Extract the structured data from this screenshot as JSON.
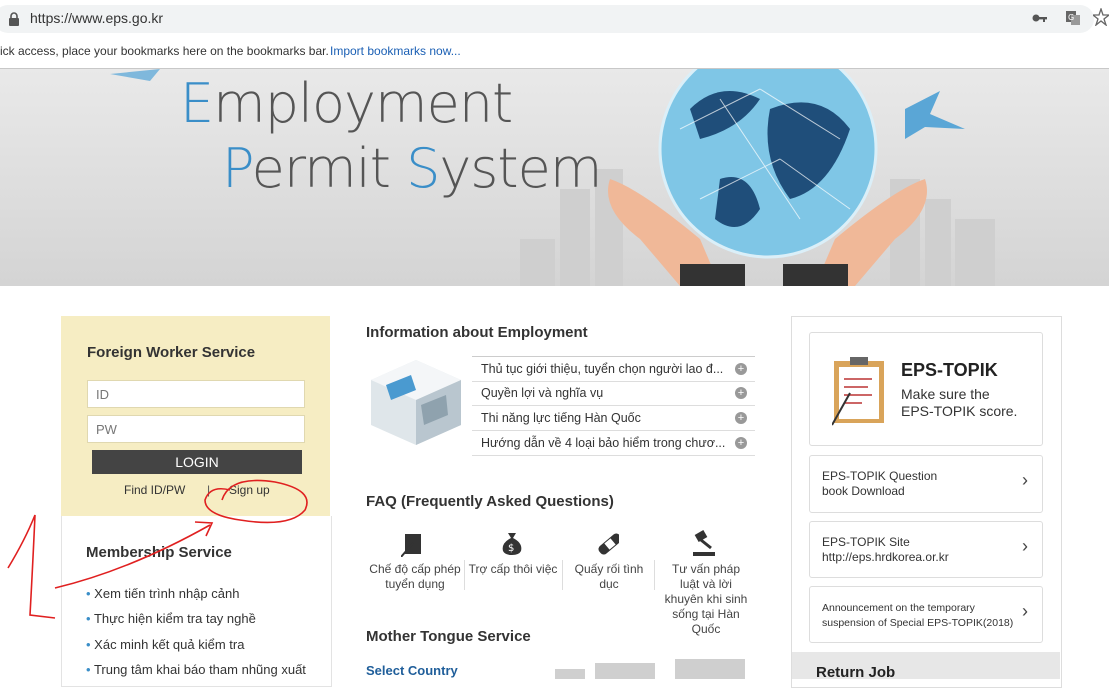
{
  "browser": {
    "url": "https://www.eps.go.kr",
    "bookmarks_text": "ick access, place your bookmarks here on the bookmarks bar.",
    "bookmarks_link": "Import bookmarks now..."
  },
  "hero": {
    "line1_initial": "E",
    "line1_rest": "mployment",
    "line2_p": "P",
    "line2_mid": "ermit ",
    "line2_s": "S",
    "line2_rest": "ystem"
  },
  "foreign_worker": {
    "title": "Foreign Worker Service",
    "id_placeholder": "ID",
    "pw_placeholder": "PW",
    "login_label": "LOGIN",
    "find_label": "Find ID/PW",
    "separator": "|",
    "signup_label": "Sign up"
  },
  "membership": {
    "title": "Membership Service",
    "items": [
      "Xem tiến trình nhập cảnh",
      "Thực hiện kiểm tra tay nghề",
      "Xác minh kết quả kiểm tra",
      "Trung tâm khai báo tham nhũng xuất"
    ]
  },
  "info": {
    "title": "Information about Employment",
    "items": [
      "Thủ tục giới thiệu, tuyển chọn người lao đ...",
      "Quyền lợi và nghĩa vụ",
      "Thi năng lực tiếng Hàn Quốc",
      "Hướng dẫn về 4 loại bảo hiểm trong chươ..."
    ],
    "plus": "+"
  },
  "faq": {
    "title": "FAQ (Frequently Asked Questions)",
    "items": [
      {
        "line1": "Chế độ cấp phép",
        "line2": "tuyển dụng",
        "icon": "license-icon"
      },
      {
        "line1": "Trợ cấp thôi việc",
        "line2": "",
        "icon": "money-bag-icon"
      },
      {
        "line1": "Quấy rối tình",
        "line2": "dục",
        "icon": "bandage-icon"
      },
      {
        "line1": "Tư vấn pháp",
        "line2": "luật và lời",
        "line3": "khuyên khi sinh",
        "line4": "sống tại Hàn",
        "line5": "Quốc",
        "icon": "gavel-icon"
      }
    ]
  },
  "mother_tongue": {
    "title": "Mother Tongue Service",
    "select_country": "Select Country"
  },
  "eps_topik": {
    "title": "EPS-TOPIK",
    "desc1": "Make sure the",
    "desc2": "EPS-TOPIK score.",
    "links": [
      {
        "line1": "EPS-TOPIK Question",
        "line2": "book Download"
      },
      {
        "line1": "EPS-TOPIK Site",
        "line2": "http://eps.hrdkorea.or.kr"
      },
      {
        "line1": "Announcement on the temporary",
        "line2": "suspension of Special EPS-TOPIK(2018)"
      }
    ],
    "chevron": "›"
  },
  "return_job": {
    "title": "Return Job"
  },
  "annotation": {
    "number": "1",
    "color": "#e02020"
  }
}
